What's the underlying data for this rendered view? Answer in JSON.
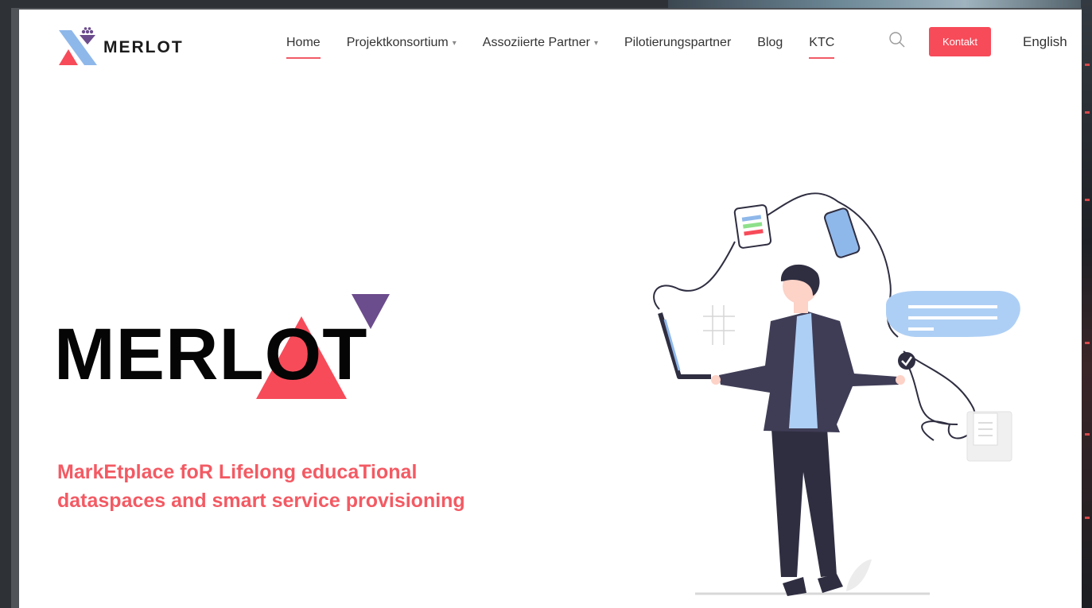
{
  "brand": {
    "name": "MERLOT"
  },
  "nav": {
    "items": [
      {
        "label": "Home",
        "active": true,
        "dropdown": false
      },
      {
        "label": "Projektkonsortium",
        "active": false,
        "dropdown": true
      },
      {
        "label": "Assoziierte Partner",
        "active": false,
        "dropdown": true
      },
      {
        "label": "Pilotierungspartner",
        "active": false,
        "dropdown": false
      },
      {
        "label": "Blog",
        "active": false,
        "dropdown": false
      },
      {
        "label": "KTC",
        "active": true,
        "dropdown": false
      }
    ],
    "contact_label": "Kontakt",
    "language_label": "English",
    "search_icon": "search-icon"
  },
  "hero": {
    "title": "MERLOT",
    "tagline_line1": "MarkEtplace foR Lifelong educaTional",
    "tagline_line2": "dataspaces and smart service provisioning"
  },
  "colors": {
    "accent": "#f74b59",
    "tagline": "#f35a63",
    "purple": "#6b4c8c",
    "logo_blue": "#8fb8ea"
  }
}
